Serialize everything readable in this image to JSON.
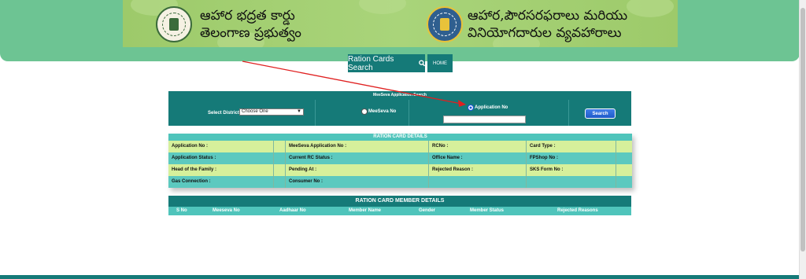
{
  "banner": {
    "left_title_line1": "ఆహార భద్రత కార్డు",
    "left_title_line2": "తెలంగాణ ప్రభుత్వం",
    "right_title_line1": "ఆహార,పౌరసరఫరాలు మరియు",
    "right_title_line2": "వినియోగదారుల వ్యవహారాలు",
    "left_emblem": "telangana-emblem-icon",
    "right_emblem": "civil-supplies-emblem-icon"
  },
  "nav": {
    "search_label": "Ration Cards Search",
    "search_icon": "magnifier-icon",
    "home_label": "HOME"
  },
  "meeseva": {
    "header": "MeeSeva Application Search",
    "select_district_label": "Select District",
    "district_value": "Choose One",
    "meeseva_no_label": "MeeSeva No",
    "application_no_label": "Application No",
    "application_no_value": "",
    "search_button": "Search"
  },
  "details": {
    "header": "RATION CARD DETAILS",
    "rows": [
      [
        "Application No :",
        "MeeSeva Application No :",
        "RCNo :",
        "Card Type :"
      ],
      [
        "Application Status :",
        "Current RC Status :",
        "Office Name :",
        "FPShop No :"
      ],
      [
        "Head of the Family :",
        "Pending At :",
        "Rejected Reason :",
        "SKS Form No :"
      ],
      [
        "Gas Connection :",
        "Consumer No :",
        "",
        ""
      ]
    ]
  },
  "members": {
    "header": "RATION CARD MEMBER DETAILS",
    "columns": [
      "S No",
      "Meeseva No",
      "Aadhaar No",
      "Member Name",
      "Gender",
      "Member Status",
      "Rejected Reasons"
    ]
  },
  "colors": {
    "teal_dark": "#157a78",
    "teal_light": "#4fc4bb",
    "green_top": "#6dc493",
    "row_light": "#d6f09b",
    "row_teal": "#5cc9bf",
    "annotation_arrow": "#e02020"
  }
}
